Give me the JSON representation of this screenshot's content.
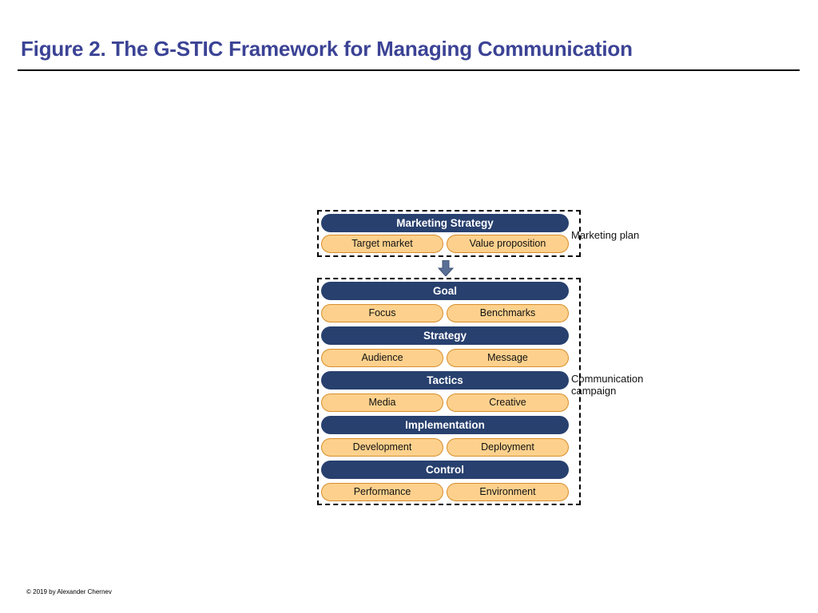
{
  "slide": {
    "title": "Figure 2. The G-STIC Framework for Managing Communication",
    "footer": "© 2019 by Alexander Chernev",
    "title_color": "#3b4395",
    "header_pill_color": "#27406e",
    "sub_pill_color": "#fdd18d",
    "sub_pill_border_color": "#d88d2a",
    "arrow_color": "#5a6f96"
  },
  "diagram": {
    "groups": [
      {
        "id": "marketing-plan",
        "annotation": "Marketing plan",
        "blocks": [
          {
            "header": "Marketing Strategy",
            "sub": [
              "Target market",
              "Value proposition"
            ]
          }
        ]
      },
      {
        "id": "communication-campaign",
        "annotation": "Communication\ncampaign",
        "blocks": [
          {
            "header": "Goal",
            "sub": [
              "Focus",
              "Benchmarks"
            ]
          },
          {
            "header": "Strategy",
            "sub": [
              "Audience",
              "Message"
            ]
          },
          {
            "header": "Tactics",
            "sub": [
              "Media",
              "Creative"
            ]
          },
          {
            "header": "Implementation",
            "sub": [
              "Development",
              "Deployment"
            ]
          },
          {
            "header": "Control",
            "sub": [
              "Performance",
              "Environment"
            ]
          }
        ]
      }
    ],
    "connector": "down-arrow"
  }
}
